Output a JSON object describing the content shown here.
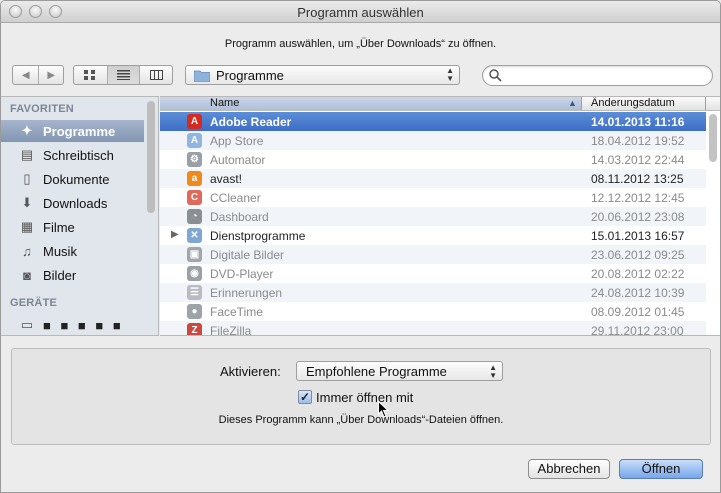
{
  "window": {
    "title": "Programm auswählen",
    "prompt": "Programm auswählen, um „Über Downloads“ zu öffnen."
  },
  "toolbar": {
    "back_icon": "chevron-left-icon",
    "forward_icon": "chevron-right-icon",
    "view_modes": [
      "icon-view",
      "list-view",
      "column-view"
    ],
    "active_view": "list-view",
    "location": "Programme",
    "search_placeholder": ""
  },
  "sidebar": {
    "favorites_header": "FAVORITEN",
    "favorites": [
      {
        "label": "Programme",
        "icon": "applications-icon",
        "selected": true
      },
      {
        "label": "Schreibtisch",
        "icon": "desktop-icon",
        "selected": false
      },
      {
        "label": "Dokumente",
        "icon": "documents-icon",
        "selected": false
      },
      {
        "label": "Downloads",
        "icon": "downloads-icon",
        "selected": false
      },
      {
        "label": "Filme",
        "icon": "movies-icon",
        "selected": false
      },
      {
        "label": "Musik",
        "icon": "music-icon",
        "selected": false
      },
      {
        "label": "Bilder",
        "icon": "pictures-icon",
        "selected": false
      }
    ],
    "devices_header": "GERÄTE",
    "devices": [
      {
        "label": "",
        "icon": "disk-icon"
      }
    ]
  },
  "filelist": {
    "columns": {
      "name": "Name",
      "date": "Änderungsdatum"
    },
    "rows": [
      {
        "name": "Adobe Reader",
        "date": "14.01.2013 11:16",
        "icon_color": "#d42b20",
        "icon_glyph": "A",
        "selected": true,
        "dim": false,
        "folder": false
      },
      {
        "name": "App Store",
        "date": "18.04.2012 19:52",
        "icon_color": "#8fb5e0",
        "icon_glyph": "A",
        "selected": false,
        "dim": true,
        "folder": false
      },
      {
        "name": "Automator",
        "date": "14.03.2012 22:44",
        "icon_color": "#9aa0a8",
        "icon_glyph": "⚙",
        "selected": false,
        "dim": true,
        "folder": false
      },
      {
        "name": "avast!",
        "date": "08.11.2012 13:25",
        "icon_color": "#f08a1c",
        "icon_glyph": "a",
        "selected": false,
        "dim": false,
        "folder": false
      },
      {
        "name": "CCleaner",
        "date": "12.12.2012 12:45",
        "icon_color": "#e06a5a",
        "icon_glyph": "C",
        "selected": false,
        "dim": true,
        "folder": false
      },
      {
        "name": "Dashboard",
        "date": "20.06.2012 23:08",
        "icon_color": "#8a8f96",
        "icon_glyph": "◔",
        "selected": false,
        "dim": true,
        "folder": false
      },
      {
        "name": "Dienstprogramme",
        "date": "15.01.2013 16:57",
        "icon_color": "#7fa7d4",
        "icon_glyph": "✕",
        "selected": false,
        "dim": false,
        "folder": true
      },
      {
        "name": "Digitale Bilder",
        "date": "23.06.2012 09:25",
        "icon_color": "#a2a6ac",
        "icon_glyph": "▣",
        "selected": false,
        "dim": true,
        "folder": false
      },
      {
        "name": "DVD-Player",
        "date": "20.08.2012 02:22",
        "icon_color": "#9aa0a6",
        "icon_glyph": "◉",
        "selected": false,
        "dim": true,
        "folder": false
      },
      {
        "name": "Erinnerungen",
        "date": "24.08.2012 10:39",
        "icon_color": "#b8bcc2",
        "icon_glyph": "☰",
        "selected": false,
        "dim": true,
        "folder": false
      },
      {
        "name": "FaceTime",
        "date": "08.09.2012 01:45",
        "icon_color": "#9da3a9",
        "icon_glyph": "●",
        "selected": false,
        "dim": true,
        "folder": false
      },
      {
        "name": "FileZilla",
        "date": "29.11.2012 23:00",
        "icon_color": "#c9483f",
        "icon_glyph": "Z",
        "selected": false,
        "dim": true,
        "folder": false
      }
    ]
  },
  "options": {
    "enable_label": "Aktivieren:",
    "enable_value": "Empfohlene Programme",
    "always_open_label": "Immer öffnen mit",
    "always_open_checked": true,
    "info": "Dieses Programm kann „Über Downloads“-Dateien öffnen."
  },
  "buttons": {
    "cancel": "Abbrechen",
    "open": "Öffnen"
  },
  "colors": {
    "selection": "#3e6dc6",
    "sidebar_bg": "#e1e6ed",
    "default_button": "#77a6ea"
  }
}
